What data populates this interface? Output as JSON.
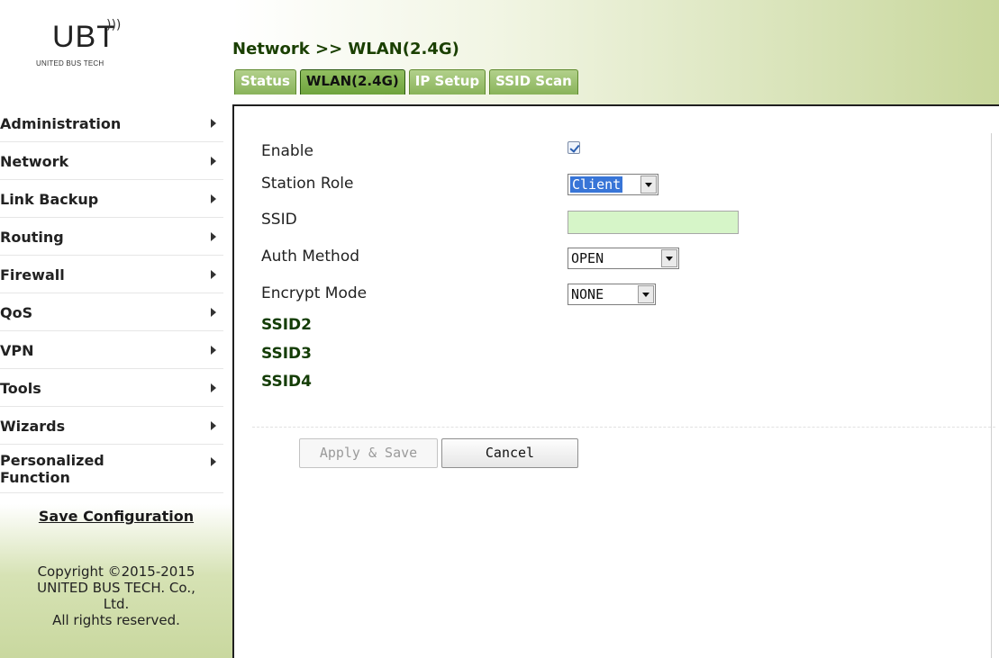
{
  "logo": {
    "brand": "UBT",
    "subtitle": "UNITED BUS TECH"
  },
  "breadcrumb": "Network >> WLAN(2.4G)",
  "tabs": [
    {
      "label": "Status",
      "active": false
    },
    {
      "label": "WLAN(2.4G)",
      "active": true
    },
    {
      "label": "IP Setup",
      "active": false
    },
    {
      "label": "SSID Scan",
      "active": false
    }
  ],
  "sidebar": {
    "items": [
      {
        "label": "Administration"
      },
      {
        "label": "Network"
      },
      {
        "label": "Link Backup"
      },
      {
        "label": "Routing"
      },
      {
        "label": "Firewall"
      },
      {
        "label": "QoS"
      },
      {
        "label": "VPN"
      },
      {
        "label": "Tools"
      },
      {
        "label": "Wizards"
      },
      {
        "label": "Personalized Function"
      }
    ],
    "save_label": "Save Configuration",
    "copyright_lines": [
      "Copyright ©2015-2015",
      "UNITED BUS TECH. Co.,",
      "Ltd.",
      "All rights reserved."
    ]
  },
  "form": {
    "enable_label": "Enable",
    "enable_checked": true,
    "role_label": "Station Role",
    "role_value": "Client",
    "ssid_label": "SSID",
    "ssid_value": "",
    "auth_label": "Auth Method",
    "auth_value": "OPEN",
    "encrypt_label": "Encrypt Mode",
    "encrypt_value": "NONE",
    "ssid_links": [
      "SSID2",
      "SSID3",
      "SSID4"
    ]
  },
  "buttons": {
    "apply_label": "Apply & Save",
    "cancel_label": "Cancel"
  },
  "colors": {
    "header_green": "#c8d79c",
    "tab_active": "#6ea33c",
    "ssid_input_bg": "#d6f5c8",
    "select_highlight": "#3875d7"
  }
}
